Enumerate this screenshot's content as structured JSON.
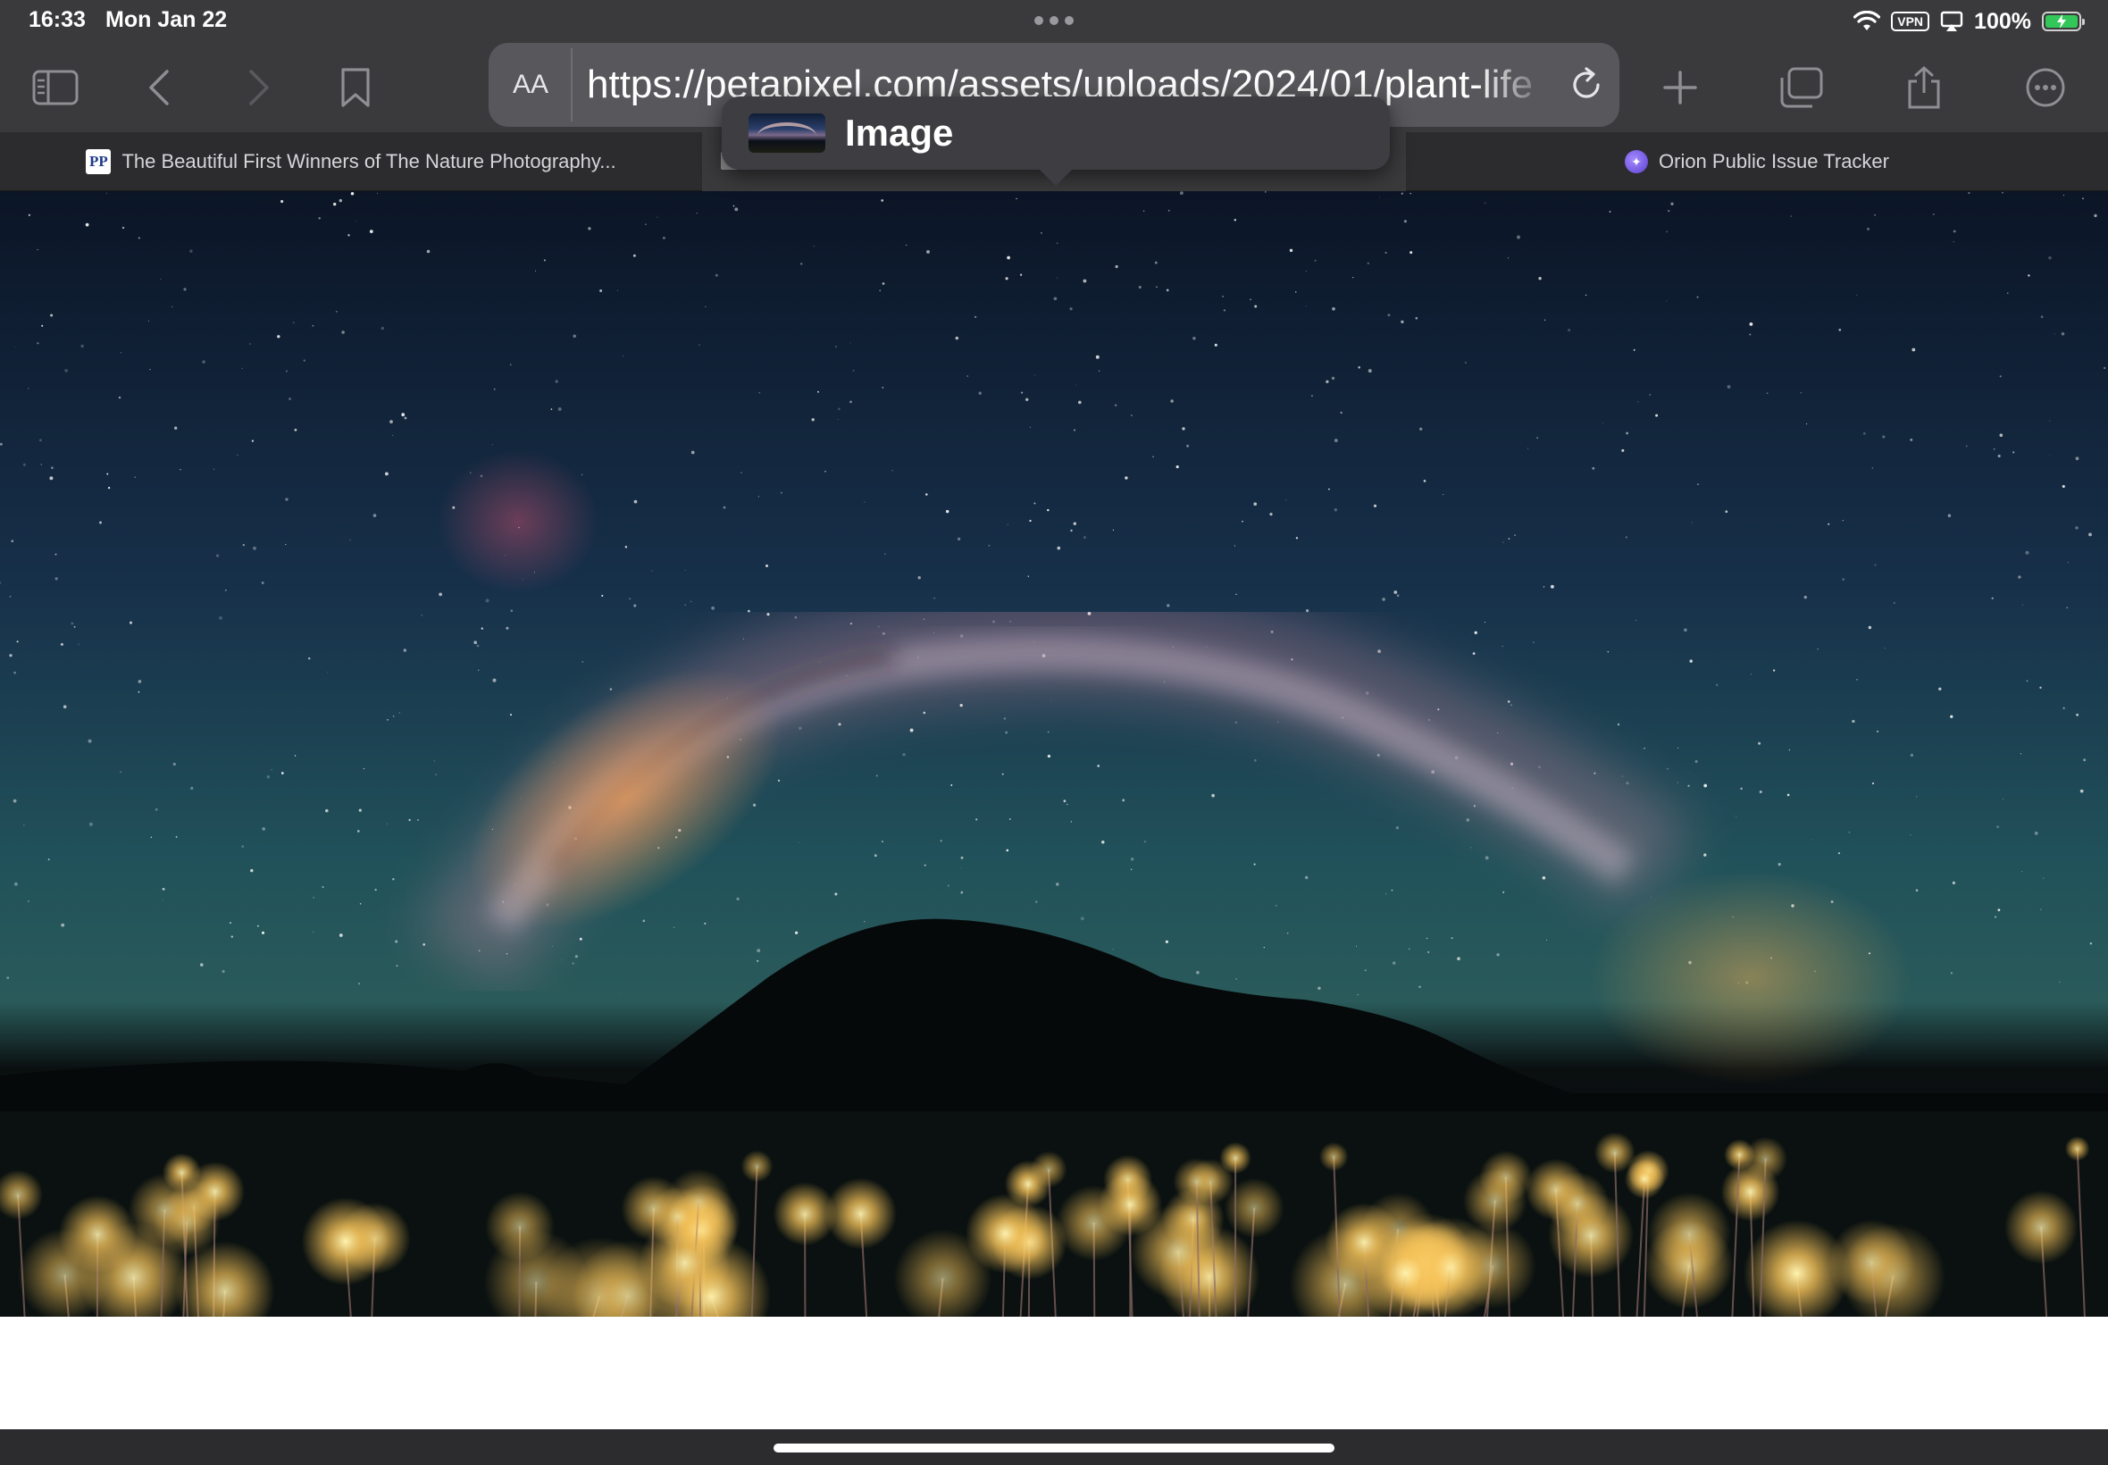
{
  "status_bar": {
    "time": "16:33",
    "date": "Mon Jan 22",
    "vpn_label": "VPN",
    "battery_percent": "100%",
    "battery_level": 1.0,
    "battery_color": "#33c759"
  },
  "toolbar": {
    "sidebar_icon": "sidebar-icon",
    "back_icon": "chevron-left-icon",
    "forward_icon": "chevron-right-icon",
    "bookmark_icon": "bookmark-icon",
    "reader_label": "AA",
    "url": "https://petapixel.com/assets/uploads/2024/01/plant-life",
    "new_tab_icon": "plus-icon",
    "tabs_icon": "tabs-overview-icon",
    "share_icon": "share-icon",
    "more_icon": "ellipsis-circle-icon"
  },
  "tabs": [
    {
      "label": "The Beautiful First Winners of The Nature Photography...",
      "favicon": "PP",
      "active": false
    },
    {
      "label": "",
      "favicon": "image",
      "active": true
    },
    {
      "label": "Orion Public Issue Tracker",
      "favicon": "orion",
      "active": false
    }
  ],
  "popover": {
    "title": "Image"
  },
  "colors": {
    "chrome_bg": "#3a3a3c",
    "tab_bar_bg": "#2c2c2e",
    "address_bar_bg": "#58585c",
    "page_bg": "#ffffff"
  }
}
